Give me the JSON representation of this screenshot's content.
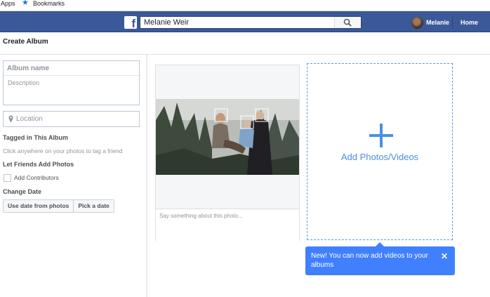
{
  "bookmarks_bar": {
    "apps_label": "Apps",
    "bookmarks_label": "Bookmarks"
  },
  "header": {
    "search_value": "Melanie Weir",
    "user_name": "Melanie",
    "home_label": "Home",
    "brand_color": "#3b5998"
  },
  "page": {
    "title": "Create Album"
  },
  "sidebar": {
    "album_name_placeholder": "Album name",
    "description_placeholder": "Description",
    "location_placeholder": "Location",
    "tagged_heading": "Tagged in This Album",
    "tagged_hint": "Click anywhere on your photos to tag a friend",
    "let_friends_heading": "Let Friends Add Photos",
    "add_contributors_label": "Add Contributors",
    "add_contributors_checked": false,
    "change_date_heading": "Change Date",
    "use_date_label": "Use date from photos",
    "pick_date_label": "Pick a date"
  },
  "photo_card": {
    "caption_placeholder": "Say something about this photo..."
  },
  "add_box": {
    "label": "Add Photos/Videos",
    "accent_color": "#4a90e2"
  },
  "tooltip": {
    "text": "New! You can now add videos to your albums",
    "close_glyph": "✕",
    "color": "#4080ff"
  }
}
